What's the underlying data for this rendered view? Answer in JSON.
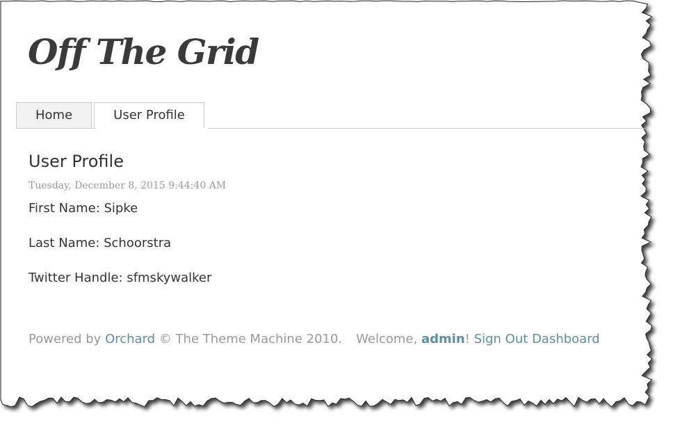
{
  "site": {
    "title": "Off The Grid"
  },
  "nav": {
    "tabs": [
      {
        "label": "Home",
        "active": false
      },
      {
        "label": "User Profile",
        "active": true
      }
    ]
  },
  "main": {
    "title": "User Profile",
    "date": "Tuesday, December 8, 2015 9:44:40 AM",
    "fields": [
      {
        "text": "First Name: Sipke"
      },
      {
        "text": "Last Name: Schoorstra"
      },
      {
        "text": "Twitter Handle: sfmskywalker"
      }
    ]
  },
  "footer": {
    "powered_by": "Powered by",
    "orchard_link": "Orchard",
    "copyright": "© The Theme Machine 2010.",
    "welcome": "Welcome,",
    "username": "admin",
    "exclaim": "!",
    "sign_out": "Sign Out",
    "dashboard": "Dashboard"
  },
  "colors": {
    "link": "#5a8fa6",
    "muted_text": "#999999",
    "body_text": "#333333",
    "tab_border": "#cccccc"
  }
}
